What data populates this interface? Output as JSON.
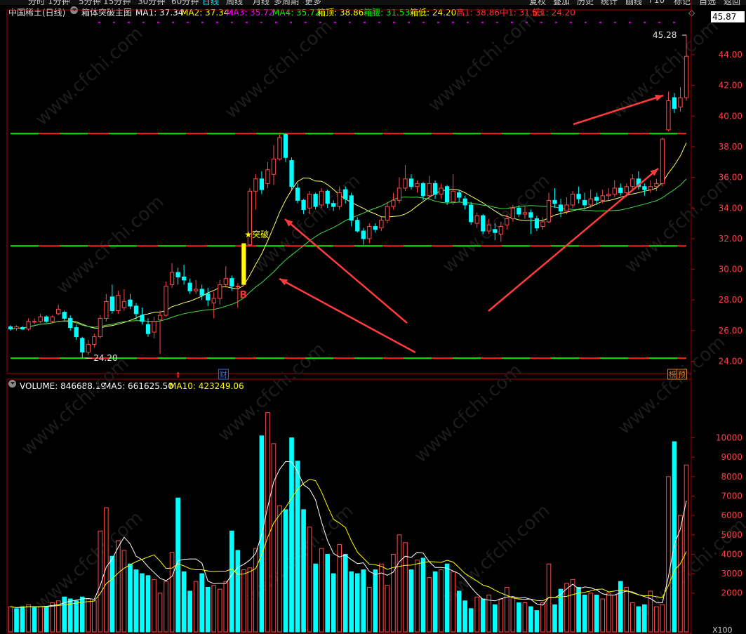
{
  "toolbar": {
    "left_tabs": [
      "分时",
      "1分钟",
      "5分钟",
      "15分钟",
      "30分钟",
      "60分钟",
      "日线",
      "周线",
      "月线",
      "多周期",
      "更多"
    ],
    "right_tabs": [
      "复权",
      "叠加",
      "历史",
      "统计",
      "画线",
      "F10",
      "标记",
      "自选",
      "返回"
    ]
  },
  "header": {
    "stock_name": "中国稀土(日线)",
    "indicator_name": "箱体突破主图",
    "items": [
      {
        "label": "MA1: 37.34",
        "color": "#ffffff"
      },
      {
        "label": "MA2: 37.34",
        "color": "#ffff00"
      },
      {
        "label": "MA3: 35.72",
        "color": "#ff00ff"
      },
      {
        "label": "MA4: 35.72",
        "color": "#00ff00"
      },
      {
        "label": "箱顶: 38.86",
        "color": "#ffff00"
      },
      {
        "label": "箱腰: 31.53",
        "color": "#00ff00"
      },
      {
        "label": "箱低: 24.20",
        "color": "#ffff00"
      },
      {
        "label": "高1: 38.86",
        "color": "#ff3333"
      },
      {
        "label": "中1: 31.53",
        "color": "#ff3333"
      },
      {
        "label": "低1: 24.20",
        "color": "#ff3333"
      }
    ],
    "last_price": "45.87"
  },
  "volume_header": {
    "items": [
      {
        "label": "VOLUME: 846688.19",
        "color": "#ffffff"
      },
      {
        "label": "MA5: 661625.50",
        "color": "#ffffff"
      },
      {
        "label": "MA10: 423249.06",
        "color": "#ffff00"
      }
    ]
  },
  "annotations": {
    "high_label": "45.28",
    "low_label": "24.20",
    "breakout_label": "★突破",
    "buy_label": "B",
    "badge_cai": "财",
    "badge_bang": "榜",
    "badge_yu": "预",
    "watermark": "www.cfchi.com"
  },
  "colors": {
    "up": "#ff4a4a",
    "down": "#00ffff",
    "box_line": "#ff2020",
    "box_dash": "#00e000",
    "ma_short": "#ffff66",
    "ma_long": "#44dd44",
    "breakout_bar": "#ffff00",
    "arrow": "#ff3b3b"
  },
  "chart_data": {
    "type": "candlestick",
    "price_axis": {
      "ylim": [
        23.2,
        46.2
      ],
      "ticks": [
        24.0,
        26.0,
        28.0,
        30.0,
        32.0,
        34.0,
        36.0,
        38.0,
        40.0,
        42.0,
        44.0
      ],
      "tick_labels": [
        "24.00",
        "26.00",
        "28.00",
        "30.00",
        "32.00",
        "34.00",
        "36.00",
        "38.00",
        "40.00",
        "42.00",
        "44.00"
      ]
    },
    "volume_axis": {
      "ylim": [
        0,
        12300
      ],
      "ticks": [
        2000,
        3000,
        4000,
        5000,
        6000,
        7000,
        8000,
        9000,
        10000
      ],
      "unit_label": "X100"
    },
    "box_levels": {
      "top": 38.86,
      "mid": 31.53,
      "low": 24.2
    },
    "ohlc": [
      [
        26.25,
        26.1,
        26.35,
        26.0
      ],
      [
        26.15,
        26.25,
        26.35,
        26.0
      ],
      [
        26.2,
        26.1,
        26.3,
        26.05
      ],
      [
        26.1,
        26.6,
        26.8,
        26.0
      ],
      [
        26.6,
        26.6,
        26.8,
        26.4
      ],
      [
        26.6,
        26.9,
        27.1,
        26.5
      ],
      [
        26.9,
        26.6,
        27.0,
        26.5
      ],
      [
        26.6,
        26.9,
        27.0,
        26.5
      ],
      [
        27.1,
        27.4,
        27.7,
        27.0
      ],
      [
        27.2,
        26.8,
        27.3,
        26.6
      ],
      [
        26.8,
        26.2,
        27.0,
        26.0
      ],
      [
        26.2,
        25.6,
        26.4,
        25.4
      ],
      [
        25.5,
        24.6,
        25.6,
        24.2
      ],
      [
        24.6,
        25.1,
        25.4,
        24.4
      ],
      [
        25.1,
        25.6,
        25.8,
        24.9
      ],
      [
        25.6,
        26.8,
        27.0,
        25.5
      ],
      [
        26.8,
        27.9,
        28.4,
        26.6
      ],
      [
        28.2,
        27.3,
        29.0,
        27.1
      ],
      [
        27.3,
        28.3,
        28.6,
        27.1
      ],
      [
        27.5,
        27.9,
        28.7,
        27.3
      ],
      [
        28.0,
        27.6,
        28.4,
        27.4
      ],
      [
        27.6,
        27.1,
        27.8,
        26.7
      ],
      [
        27.0,
        26.6,
        27.5,
        26.4
      ],
      [
        26.4,
        25.8,
        26.8,
        25.6
      ],
      [
        25.9,
        26.6,
        26.9,
        25.5
      ],
      [
        26.7,
        27.0,
        27.3,
        24.5
      ],
      [
        27.0,
        28.9,
        29.2,
        26.9
      ],
      [
        29.0,
        29.8,
        30.4,
        28.8
      ],
      [
        29.8,
        29.5,
        30.1,
        29.0
      ],
      [
        29.5,
        29.3,
        30.3,
        29.0
      ],
      [
        29.1,
        28.6,
        29.4,
        28.4
      ],
      [
        28.6,
        28.7,
        29.3,
        28.4
      ],
      [
        28.7,
        28.3,
        29.0,
        28.0
      ],
      [
        28.4,
        28.0,
        28.8,
        27.6
      ],
      [
        27.8,
        28.1,
        28.5,
        26.8
      ],
      [
        28.1,
        29.0,
        29.3,
        27.7
      ],
      [
        29.0,
        29.4,
        30.2,
        28.8
      ],
      [
        29.4,
        28.9,
        29.6,
        28.6
      ],
      [
        28.9,
        28.9,
        29.1,
        27.5
      ],
      [
        29.0,
        31.6,
        31.7,
        28.9
      ],
      [
        31.6,
        35.1,
        35.3,
        31.5
      ],
      [
        35.1,
        35.9,
        36.2,
        33.9
      ],
      [
        35.9,
        35.2,
        36.4,
        34.9
      ],
      [
        35.6,
        36.5,
        37.0,
        35.3
      ],
      [
        36.2,
        37.2,
        38.1,
        35.5
      ],
      [
        37.2,
        38.6,
        38.9,
        37.1
      ],
      [
        38.8,
        37.3,
        38.9,
        37.0
      ],
      [
        37.1,
        35.4,
        37.3,
        35.2
      ],
      [
        35.3,
        34.5,
        35.6,
        34.3
      ],
      [
        34.5,
        33.9,
        34.6,
        33.6
      ],
      [
        34.0,
        34.9,
        35.1,
        33.6
      ],
      [
        34.9,
        34.1,
        35.0,
        33.9
      ],
      [
        34.2,
        35.1,
        35.3,
        34.0
      ],
      [
        35.1,
        34.3,
        35.2,
        34.0
      ],
      [
        34.3,
        34.1,
        34.5,
        33.8
      ],
      [
        34.1,
        35.0,
        35.4,
        33.9
      ],
      [
        35.2,
        34.6,
        35.4,
        34.3
      ],
      [
        34.8,
        33.2,
        35.0,
        32.8
      ],
      [
        33.2,
        32.5,
        33.4,
        32.4
      ],
      [
        32.5,
        32.0,
        32.7,
        31.6
      ],
      [
        32.0,
        32.8,
        33.0,
        31.7
      ],
      [
        32.8,
        32.6,
        33.0,
        32.4
      ],
      [
        32.7,
        33.2,
        33.4,
        32.5
      ],
      [
        33.2,
        34.1,
        34.4,
        33.0
      ],
      [
        34.1,
        34.5,
        35.0,
        33.9
      ],
      [
        34.5,
        35.3,
        36.0,
        34.3
      ],
      [
        35.3,
        35.9,
        36.8,
        35.1
      ],
      [
        35.9,
        35.4,
        36.2,
        35.2
      ],
      [
        35.4,
        35.6,
        35.8,
        35.0
      ],
      [
        35.6,
        34.8,
        35.7,
        34.5
      ],
      [
        34.8,
        35.6,
        36.1,
        34.6
      ],
      [
        35.6,
        34.9,
        35.8,
        34.6
      ],
      [
        34.9,
        35.3,
        35.6,
        34.6
      ],
      [
        35.4,
        34.4,
        35.5,
        34.2
      ],
      [
        34.4,
        35.1,
        36.2,
        34.2
      ],
      [
        35.0,
        34.7,
        35.2,
        34.4
      ],
      [
        34.6,
        34.2,
        34.8,
        33.9
      ],
      [
        34.2,
        33.1,
        34.4,
        32.9
      ],
      [
        33.0,
        33.5,
        33.7,
        32.7
      ],
      [
        33.5,
        32.5,
        33.6,
        32.3
      ],
      [
        32.5,
        32.9,
        33.3,
        32.3
      ],
      [
        32.6,
        32.4,
        33.0,
        31.9
      ],
      [
        32.3,
        32.8,
        33.1,
        31.8
      ],
      [
        32.9,
        33.3,
        33.6,
        32.6
      ],
      [
        33.3,
        34.0,
        34.2,
        33.1
      ],
      [
        34.0,
        33.6,
        34.2,
        33.4
      ],
      [
        33.6,
        33.7,
        34.1,
        33.3
      ],
      [
        33.7,
        33.4,
        33.9,
        32.3
      ],
      [
        33.3,
        32.7,
        33.5,
        32.5
      ],
      [
        32.8,
        33.1,
        33.4,
        32.6
      ],
      [
        33.1,
        34.5,
        35.0,
        33.0
      ],
      [
        34.5,
        34.3,
        35.3,
        34.0
      ],
      [
        34.2,
        33.8,
        34.6,
        33.4
      ],
      [
        33.8,
        34.2,
        34.7,
        33.6
      ],
      [
        34.2,
        34.9,
        35.1,
        34.0
      ],
      [
        34.9,
        34.6,
        35.4,
        34.3
      ],
      [
        34.5,
        34.2,
        35.0,
        33.9
      ],
      [
        34.2,
        34.6,
        35.2,
        34.0
      ],
      [
        34.7,
        34.5,
        35.0,
        34.2
      ],
      [
        34.5,
        34.8,
        35.2,
        34.3
      ],
      [
        34.8,
        34.9,
        35.3,
        34.5
      ],
      [
        34.9,
        35.3,
        35.8,
        34.7
      ],
      [
        35.3,
        35.0,
        35.6,
        34.8
      ],
      [
        35.0,
        35.4,
        35.6,
        34.7
      ],
      [
        35.4,
        35.9,
        36.2,
        35.1
      ],
      [
        35.9,
        35.4,
        36.4,
        35.2
      ],
      [
        35.4,
        35.2,
        35.6,
        34.8
      ],
      [
        35.2,
        35.4,
        35.8,
        35.0
      ],
      [
        35.4,
        35.6,
        35.9,
        35.1
      ],
      [
        35.6,
        38.5,
        38.6,
        35.4
      ],
      [
        39.1,
        41.0,
        41.6,
        39.0
      ],
      [
        41.2,
        40.5,
        41.5,
        40.2
      ],
      [
        40.6,
        41.2,
        41.9,
        40.3
      ],
      [
        41.2,
        43.9,
        45.28,
        41.0
      ]
    ],
    "volume": [
      1300,
      1200,
      1300,
      1400,
      1300,
      1300,
      1300,
      1500,
      1600,
      1800,
      1700,
      1600,
      1800,
      1700,
      1600,
      5200,
      6400,
      3900,
      4700,
      4200,
      3500,
      3200,
      3000,
      2900,
      2700,
      2000,
      2600,
      4100,
      6900,
      3100,
      2100,
      2600,
      3000,
      2300,
      2400,
      2200,
      2600,
      5200,
      4200,
      3200,
      3300,
      4300,
      10100,
      11300,
      9700,
      6500,
      6300,
      10000,
      8800,
      6300,
      5400,
      3500,
      4300,
      4000,
      3000,
      4500,
      4000,
      3100,
      3000,
      3200,
      2300,
      3200,
      3500,
      2400,
      4000,
      5000,
      4600,
      3200,
      3700,
      3800,
      2800,
      3100,
      3200,
      3500,
      3100,
      2100,
      1600,
      1200,
      1800,
      1700,
      1900,
      1400,
      1700,
      2300,
      1800,
      1500,
      1500,
      1300,
      1100,
      1500,
      3500,
      1400,
      2200,
      2500,
      2700,
      2300,
      1900,
      2000,
      1900,
      1700,
      2000,
      1900,
      2600,
      2300,
      1500,
      1300,
      1400,
      2100,
      1300,
      1400,
      8000,
      9800,
      6000,
      8600
    ],
    "volume_up": [
      true,
      false,
      false,
      true,
      false,
      true,
      false,
      true,
      true,
      false,
      false,
      false,
      false,
      true,
      true,
      true,
      true,
      false,
      true,
      true,
      false,
      false,
      false,
      false,
      true,
      true,
      true,
      true,
      false,
      false,
      false,
      true,
      false,
      false,
      true,
      true,
      true,
      false,
      false,
      true,
      true,
      true,
      false,
      true,
      true,
      true,
      false,
      false,
      false,
      false,
      true,
      false,
      true,
      false,
      false,
      true,
      false,
      false,
      false,
      false,
      true,
      false,
      true,
      true,
      true,
      true,
      true,
      false,
      true,
      false,
      true,
      false,
      true,
      false,
      true,
      false,
      false,
      false,
      true,
      false,
      true,
      false,
      true,
      true,
      true,
      false,
      true,
      false,
      false,
      true,
      true,
      false,
      false,
      true,
      true,
      false,
      false,
      true,
      false,
      true,
      true,
      true,
      false,
      true,
      true,
      false,
      false,
      true,
      true,
      true,
      true,
      false,
      true,
      true
    ]
  }
}
